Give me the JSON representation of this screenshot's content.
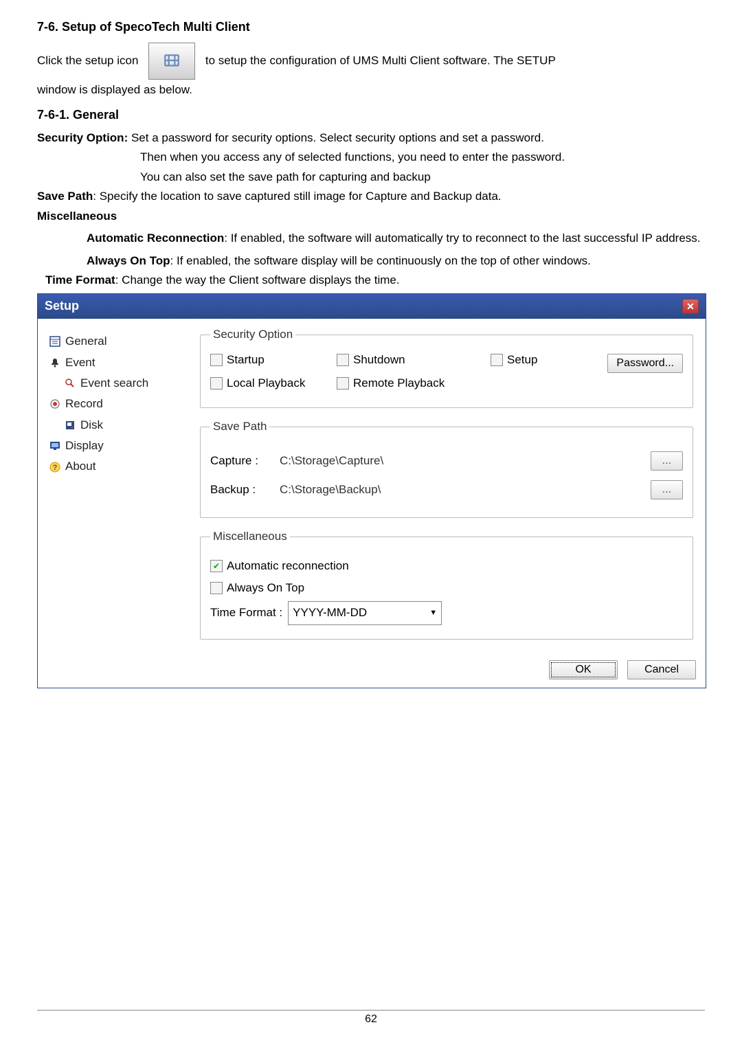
{
  "headings": {
    "h1": "7-6.  Setup  of  SpecoTech  Multi  Client",
    "h2": "7-6-1.  General"
  },
  "para": {
    "p1a": "Click  the  setup  icon",
    "p1b": "to  setup  the  configuration  of  UMS  Multi  Client  software.  The  SETUP",
    "p1c": "window is displayed as below.",
    "sec_opt_label": "Security Option:",
    "sec_opt_text": " Set a password for security options. Select security options and set a password.",
    "sec_opt_l2": "Then when you access any of selected functions, you need to enter the password.",
    "sec_opt_l3": "You can also set the save path for capturing and backup",
    "save_path_label": "Save Path",
    "save_path_text": ": Specify the location to save captured still image for Capture and Backup data.",
    "misc_label": "Miscellaneous",
    "auto_label": "Automatic  Reconnection",
    "auto_text": ":  If  enabled,  the  software  will  automatically  try  to  reconnect  to  the  last successful IP address.",
    "aot_label": "Always On Top",
    "aot_text": ": If enabled, the software display will be continuously on the top of other windows.",
    "tf_label": "Time Format",
    "tf_text": ": Change the way the Client software displays the time."
  },
  "setup": {
    "title": "Setup",
    "tree": {
      "general": "General",
      "event": "Event",
      "eventsearch": "Event search",
      "record": "Record",
      "disk": "Disk",
      "display": "Display",
      "about": "About"
    },
    "groups": {
      "security": "Security Option",
      "savepath": "Save Path",
      "misc": "Miscellaneous"
    },
    "security": {
      "startup": "Startup",
      "shutdown": "Shutdown",
      "setup": "Setup",
      "local": "Local Playback",
      "remote": "Remote Playback",
      "password_btn": "Password..."
    },
    "savepath": {
      "capture_label": "Capture :",
      "capture_val": "C:\\Storage\\Capture\\",
      "backup_label": "Backup :",
      "backup_val": "C:\\Storage\\Backup\\",
      "browse": "..."
    },
    "misc": {
      "auto": "Automatic reconnection",
      "aot": "Always On Top",
      "tf_label": "Time Format :",
      "tf_value": "YYYY-MM-DD"
    },
    "buttons": {
      "ok": "OK",
      "cancel": "Cancel"
    }
  },
  "footer": {
    "page": "62"
  }
}
